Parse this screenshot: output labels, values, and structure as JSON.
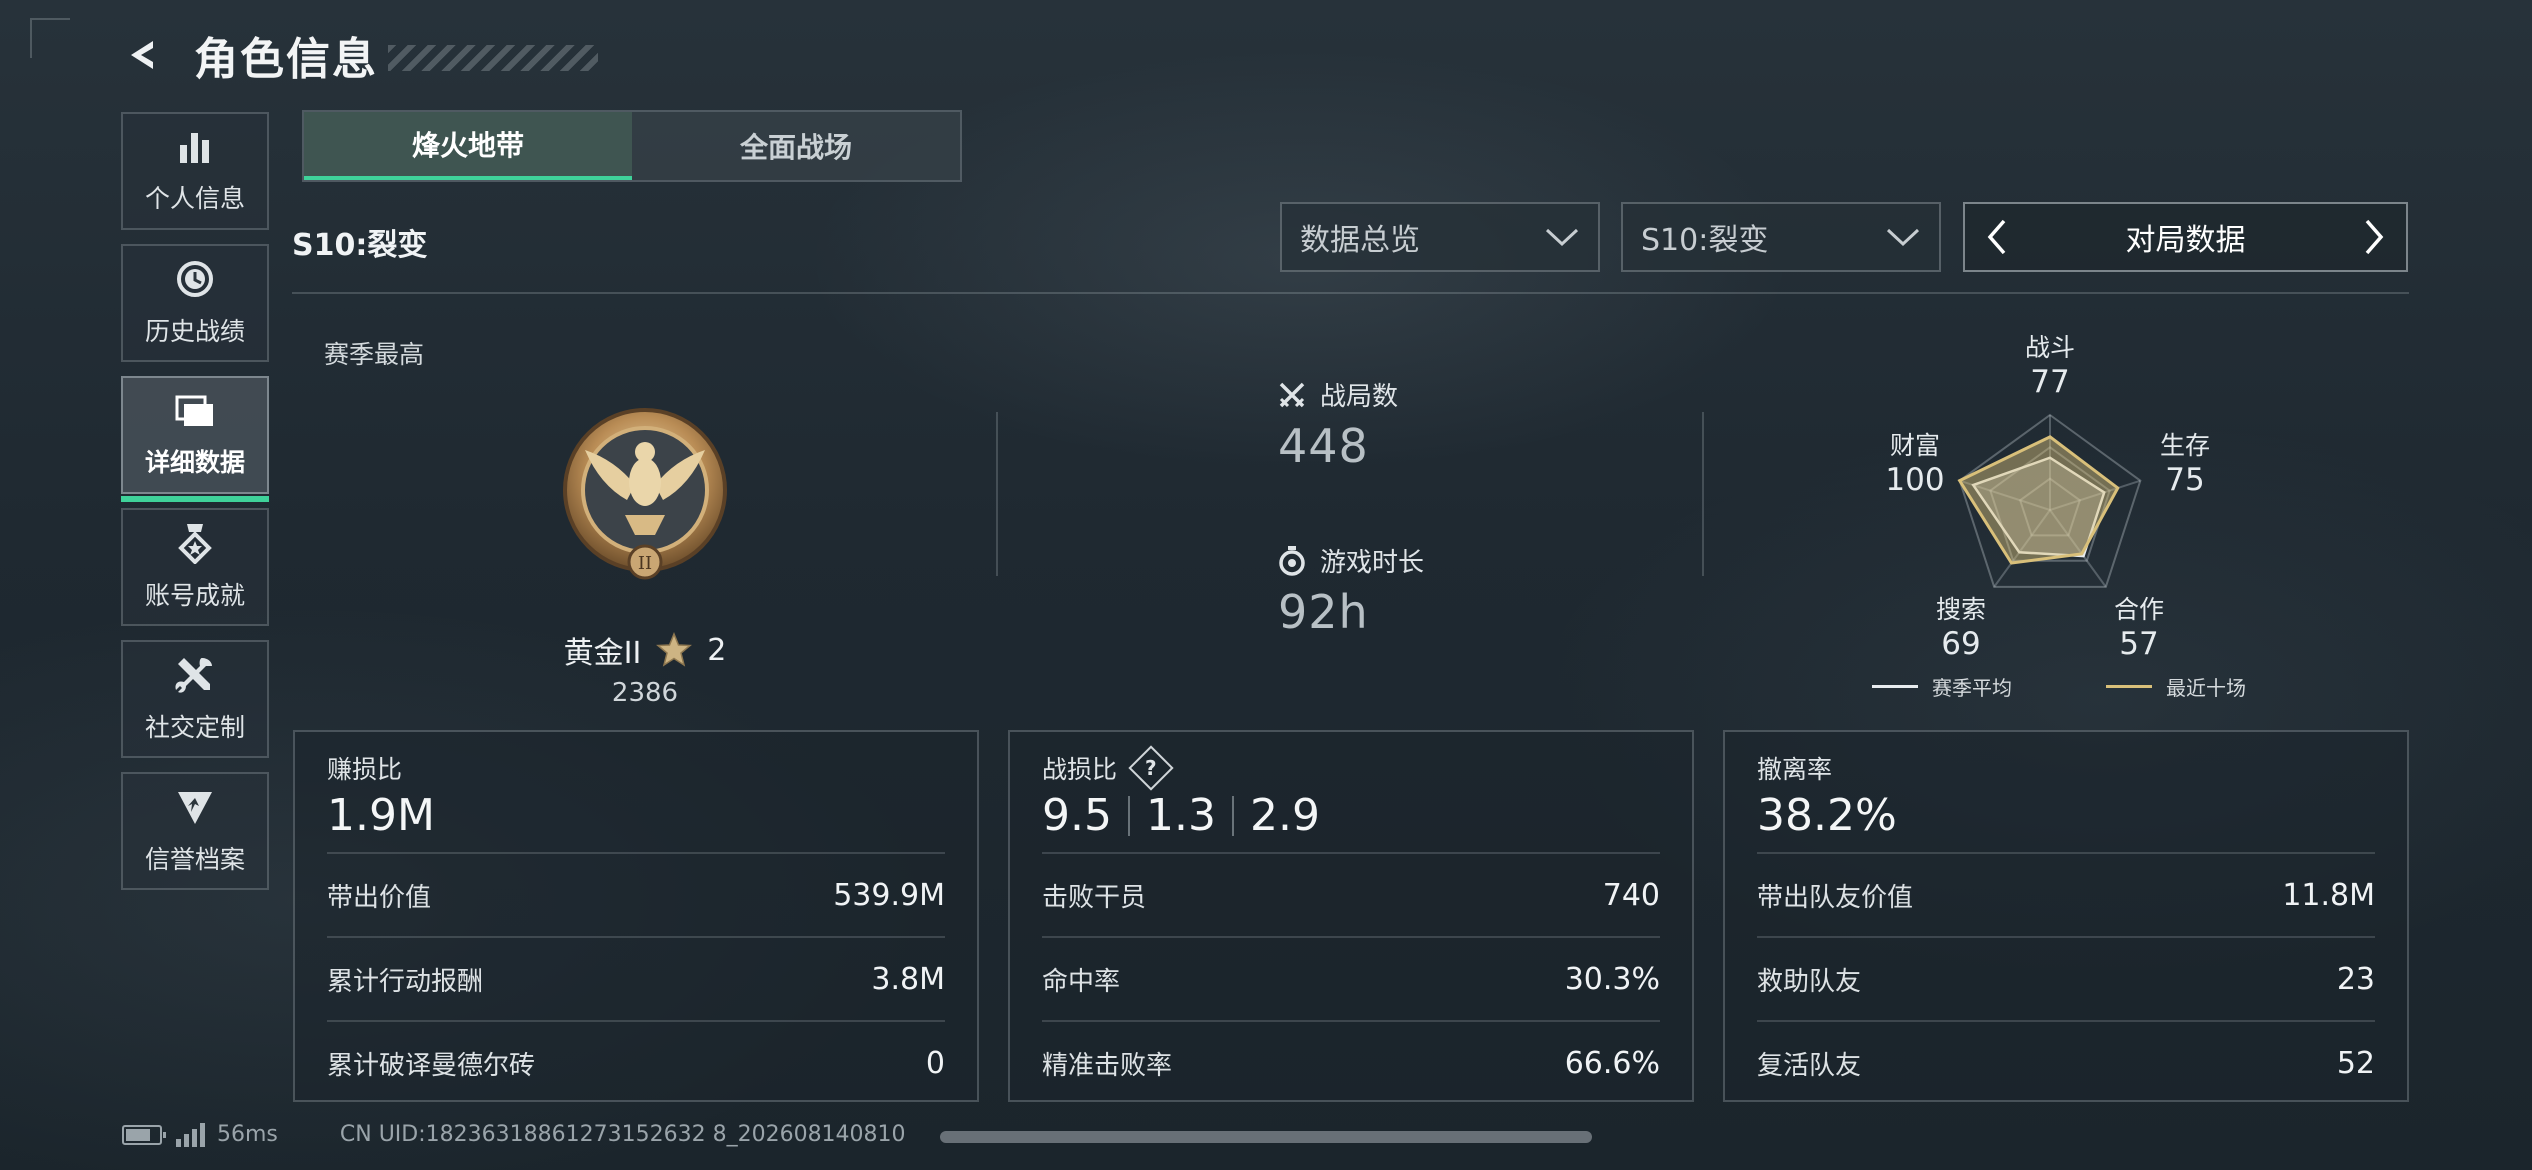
{
  "header": {
    "title": "角色信息"
  },
  "sidebar": {
    "items": [
      {
        "label": "个人信息",
        "icon": "bar-chart-icon"
      },
      {
        "label": "历史战绩",
        "icon": "history-clock-icon"
      },
      {
        "label": "详细数据",
        "icon": "folder-icon",
        "active": true
      },
      {
        "label": "账号成就",
        "icon": "medal-icon"
      },
      {
        "label": "社交定制",
        "icon": "tools-icon"
      },
      {
        "label": "信誉档案",
        "icon": "shield-badge-icon"
      }
    ]
  },
  "tabs": [
    {
      "label": "烽火地带",
      "active": true
    },
    {
      "label": "全面战场",
      "active": false
    }
  ],
  "season_label": "S10:裂变",
  "filters": {
    "overview": "数据总览",
    "season": "S10:裂变",
    "mode": "对局数据"
  },
  "season_best": {
    "title": "赛季最高",
    "rank_name": "黄金II",
    "stars": "2",
    "score": "2386"
  },
  "stats": {
    "matches": {
      "label": "战局数",
      "value": "448"
    },
    "playtime": {
      "label": "游戏时长",
      "value": "92h"
    }
  },
  "radar": {
    "axes": [
      {
        "name": "战斗",
        "value": "77",
        "season_avg": 0.55
      },
      {
        "name": "生存",
        "value": "75",
        "season_avg": 0.6
      },
      {
        "name": "合作",
        "value": "57",
        "season_avg": 0.6
      },
      {
        "name": "搜索",
        "value": "69",
        "season_avg": 0.55
      },
      {
        "name": "财富",
        "value": "100",
        "season_avg": 0.85
      }
    ],
    "legend": {
      "season_avg": "赛季平均",
      "recent": "最近十场"
    },
    "colors": {
      "season_avg": "#e8ecef",
      "recent": "#d9c07a"
    }
  },
  "cards": {
    "profit": {
      "title": "赚损比",
      "value": "1.9M",
      "rows": [
        {
          "label": "带出价值",
          "value": "539.9M"
        },
        {
          "label": "累计行动报酬",
          "value": "3.8M"
        },
        {
          "label": "累计破译曼德尔砖",
          "value": "0"
        }
      ]
    },
    "combat": {
      "title": "战损比",
      "help": "?",
      "values": [
        "9.5",
        "1.3",
        "2.9"
      ],
      "rows": [
        {
          "label": "击败干员",
          "value": "740"
        },
        {
          "label": "命中率",
          "value": "30.3%"
        },
        {
          "label": "精准击败率",
          "value": "66.6%"
        }
      ]
    },
    "extract": {
      "title": "撤离率",
      "value": "38.2%",
      "rows": [
        {
          "label": "带出队友价值",
          "value": "11.8M"
        },
        {
          "label": "救助队友",
          "value": "23"
        },
        {
          "label": "复活队友",
          "value": "52"
        }
      ]
    }
  },
  "footer": {
    "ping": "56ms",
    "uid": "CN UID:18236318861273152632 8_202608140810"
  },
  "colors": {
    "accent": "#3fd29a",
    "gold": "#d9c07a"
  }
}
